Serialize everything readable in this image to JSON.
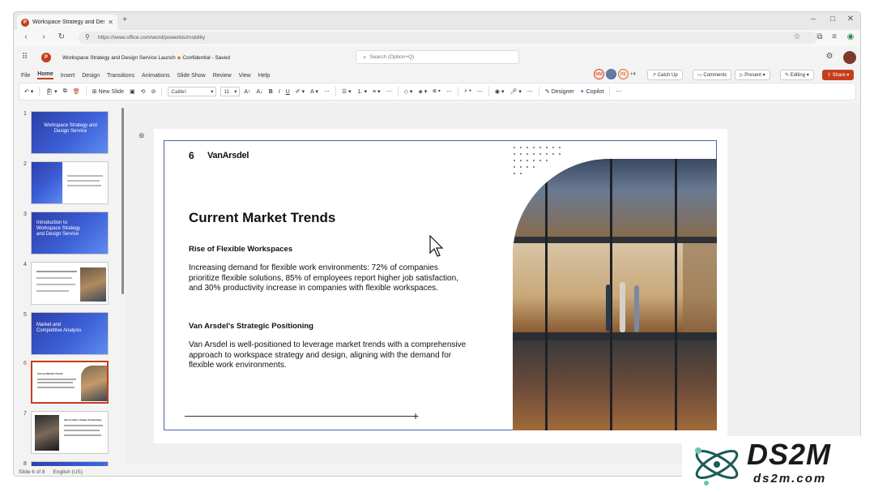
{
  "browser": {
    "tab_title": "Workspace Strategy and Des...",
    "url": "https://www.office.com/word/powerbis/mobility"
  },
  "app": {
    "doc_title": "Workspace Strategy and Design Service Launch",
    "confidential": "Confidential",
    "saved": "Saved",
    "search_placeholder": "Search (Option+Q)",
    "presence_count": "+4",
    "avatar_1": "MM",
    "avatar_3": "PE"
  },
  "menu": {
    "items": [
      "File",
      "Home",
      "Insert",
      "Design",
      "Transitions",
      "Animations",
      "Slide Show",
      "Review",
      "View",
      "Help"
    ],
    "catch_up": "Catch Up",
    "comments": "Comments",
    "present": "Present",
    "editing": "Editing",
    "share": "Share"
  },
  "ribbon": {
    "new_slide": "New Slide",
    "font": "Calibri",
    "font_size": "11",
    "designer": "Designer",
    "copilot": "Copilot"
  },
  "thumbnails": [
    {
      "num": "1",
      "title": "Workspace Strategy and Design Service"
    },
    {
      "num": "2",
      "title": ""
    },
    {
      "num": "3",
      "title": "Introduction to Workspace Strategy and Design Service"
    },
    {
      "num": "4",
      "title": ""
    },
    {
      "num": "5",
      "title": "Market and Competitive Analysis"
    },
    {
      "num": "6",
      "title": "Current Market Trends"
    },
    {
      "num": "7",
      "title": "Van Arsdel's Unique Positioning"
    },
    {
      "num": "8",
      "title": ""
    }
  ],
  "slide": {
    "number": "6",
    "brand": "VanArsdel",
    "title": "Current Market Trends",
    "h1": "Rise of Flexible Workspaces",
    "p1": "Increasing demand for flexible work environments: 72% of companies prioritize flexible solutions, 85% of employees report higher job satisfaction, and 30% productivity increase in companies with flexible workspaces.",
    "h2": "Van Arsdel's Strategic Positioning",
    "p2": "Van Arsdel is well-positioned to leverage market trends with a comprehensive approach to workspace strategy and design, aligning with the demand for flexible work environments."
  },
  "status": {
    "slide_of": "Slide 6 of 8",
    "language": "English (US)"
  },
  "watermark": {
    "logo": "DS2M",
    "site": "ds2m.com"
  },
  "colors": {
    "accent": "#c43e1c",
    "slide_blue": "#2d3fa8",
    "frame_border": "#4a5fb0"
  }
}
